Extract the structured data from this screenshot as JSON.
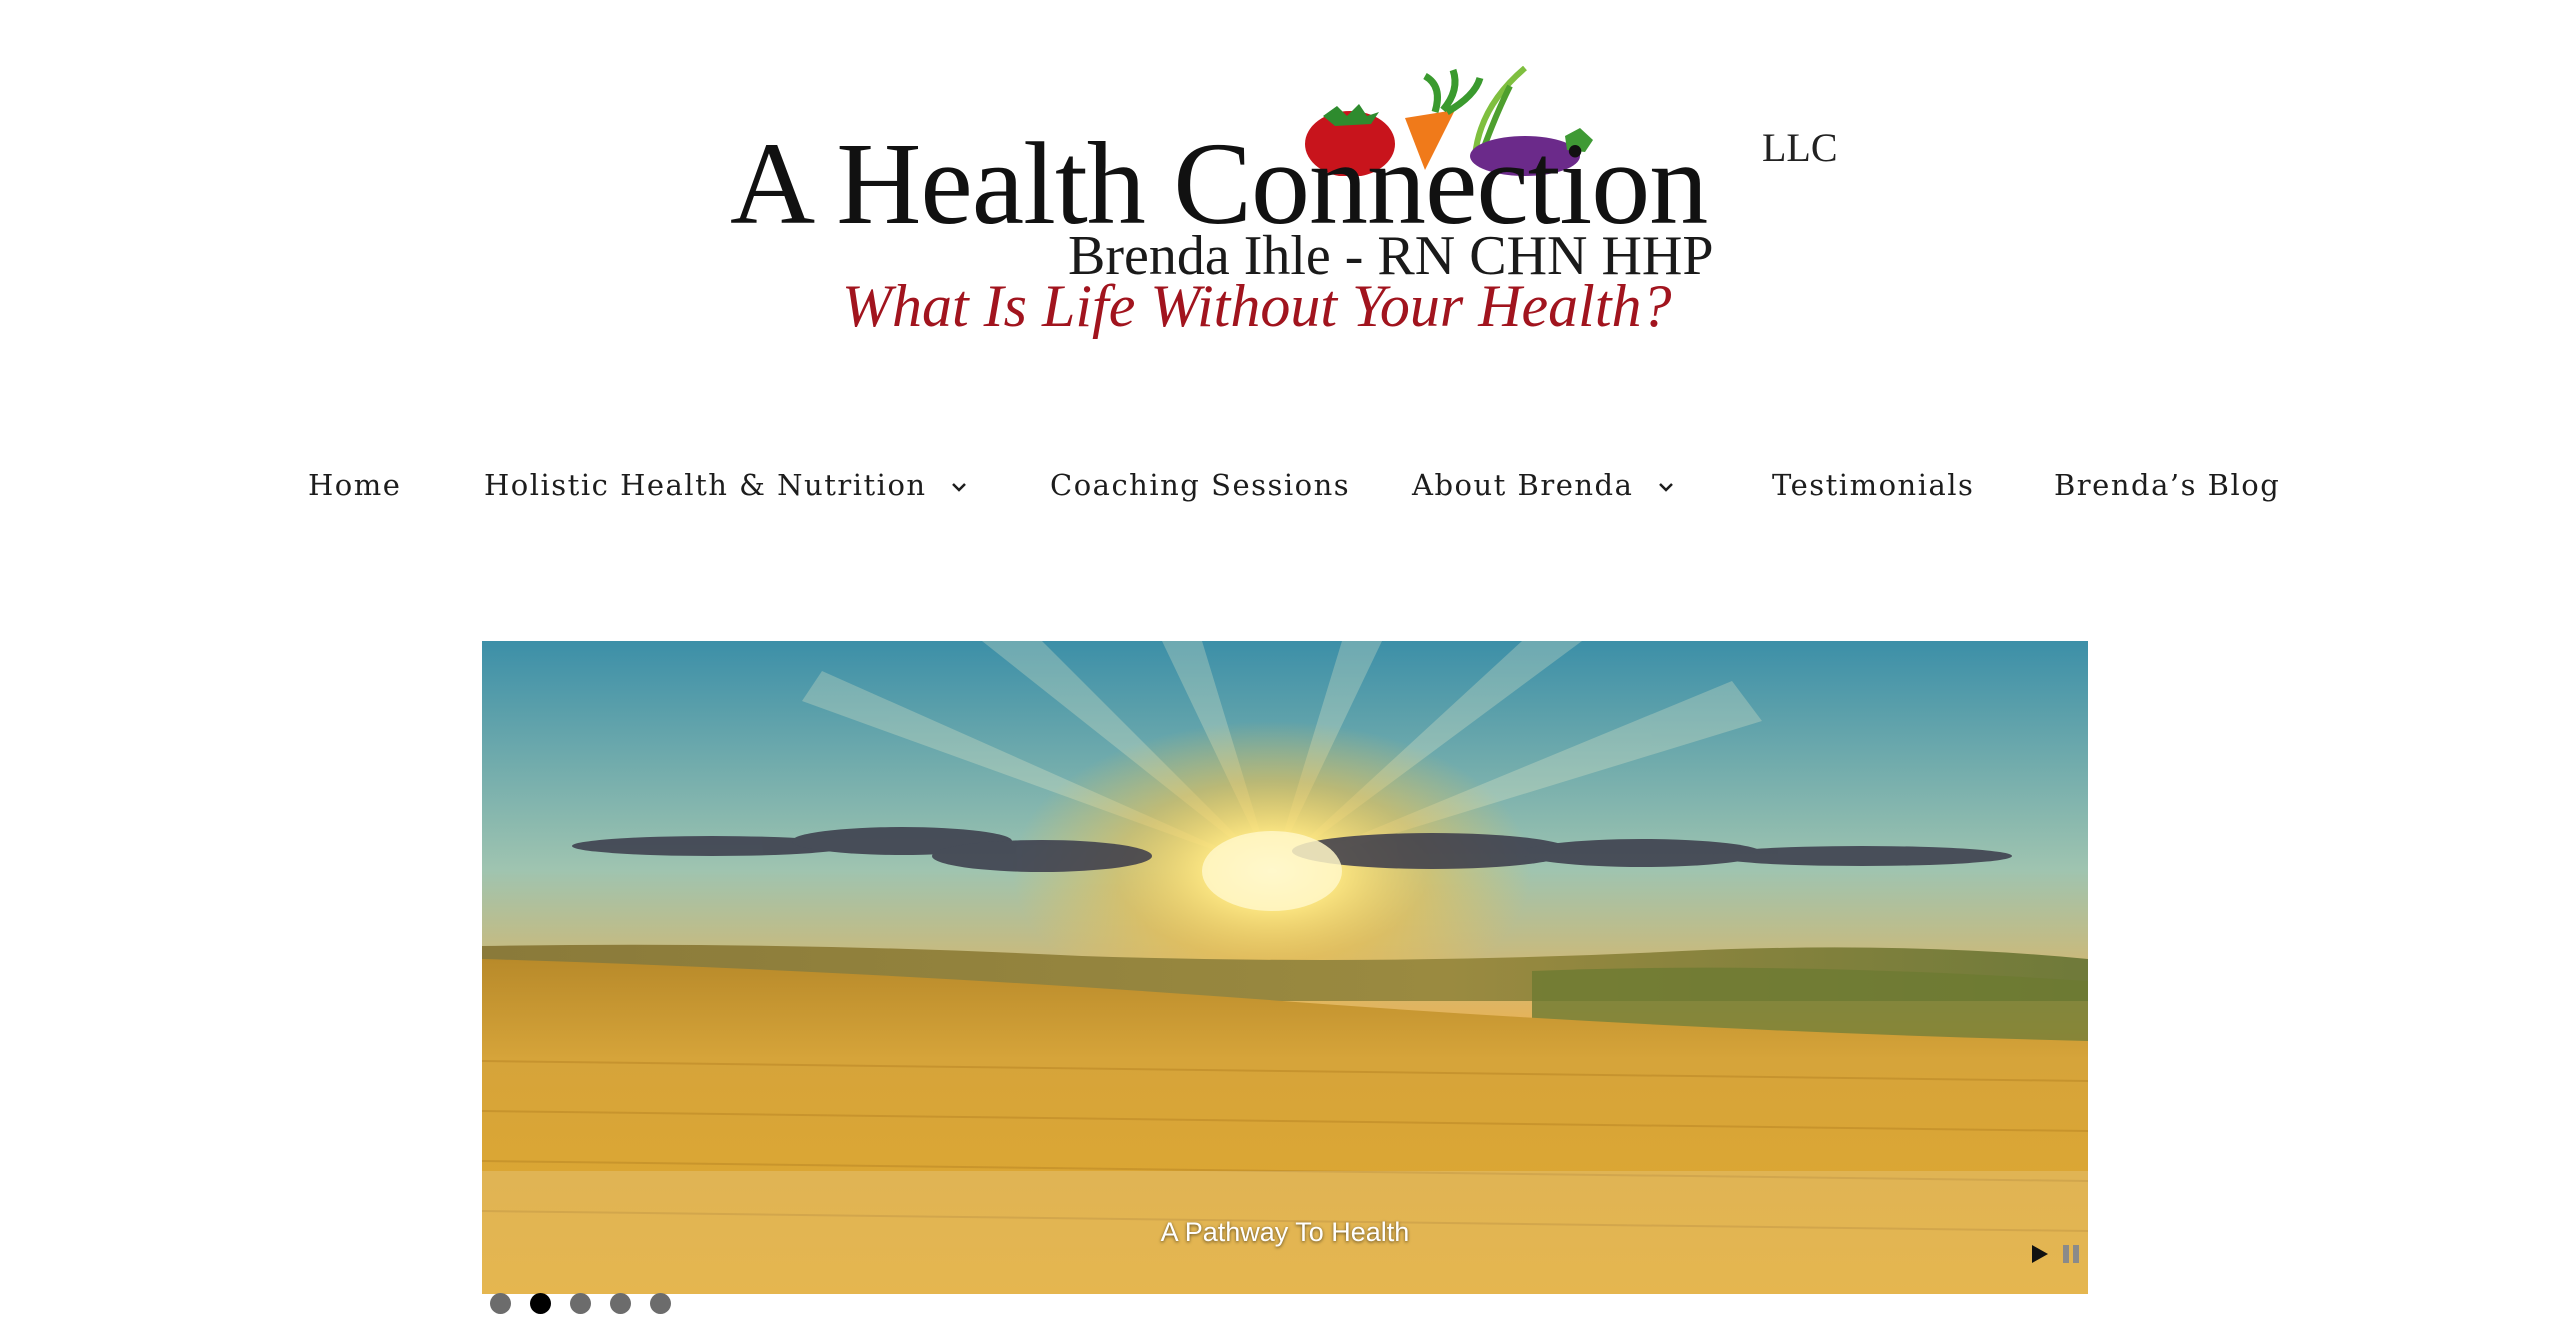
{
  "logo": {
    "title": "A Health Connection",
    "suffix": "LLC",
    "subtitle": "Brenda Ihle - RN CHN HHP",
    "tagline": "What Is Life Without Your Health?"
  },
  "nav": {
    "items": [
      {
        "label": "Home",
        "has_dropdown": false
      },
      {
        "label": "Holistic Health & Nutrition",
        "has_dropdown": true
      },
      {
        "label": "Coaching Sessions",
        "has_dropdown": false
      },
      {
        "label": "About Brenda",
        "has_dropdown": true
      },
      {
        "label": "Testimonials",
        "has_dropdown": false
      },
      {
        "label": "Brenda’s Blog",
        "has_dropdown": false
      }
    ]
  },
  "slider": {
    "caption": "A Pathway To Health",
    "slide_count": 5,
    "active_index": 1,
    "controls": {
      "play_icon": "play-icon",
      "pause_icon": "pause-icon"
    }
  },
  "colors": {
    "tagline": "#a1141e",
    "nav_text": "#1d1d1d",
    "dot_inactive": "#6c6c6c",
    "dot_active": "#000000"
  }
}
